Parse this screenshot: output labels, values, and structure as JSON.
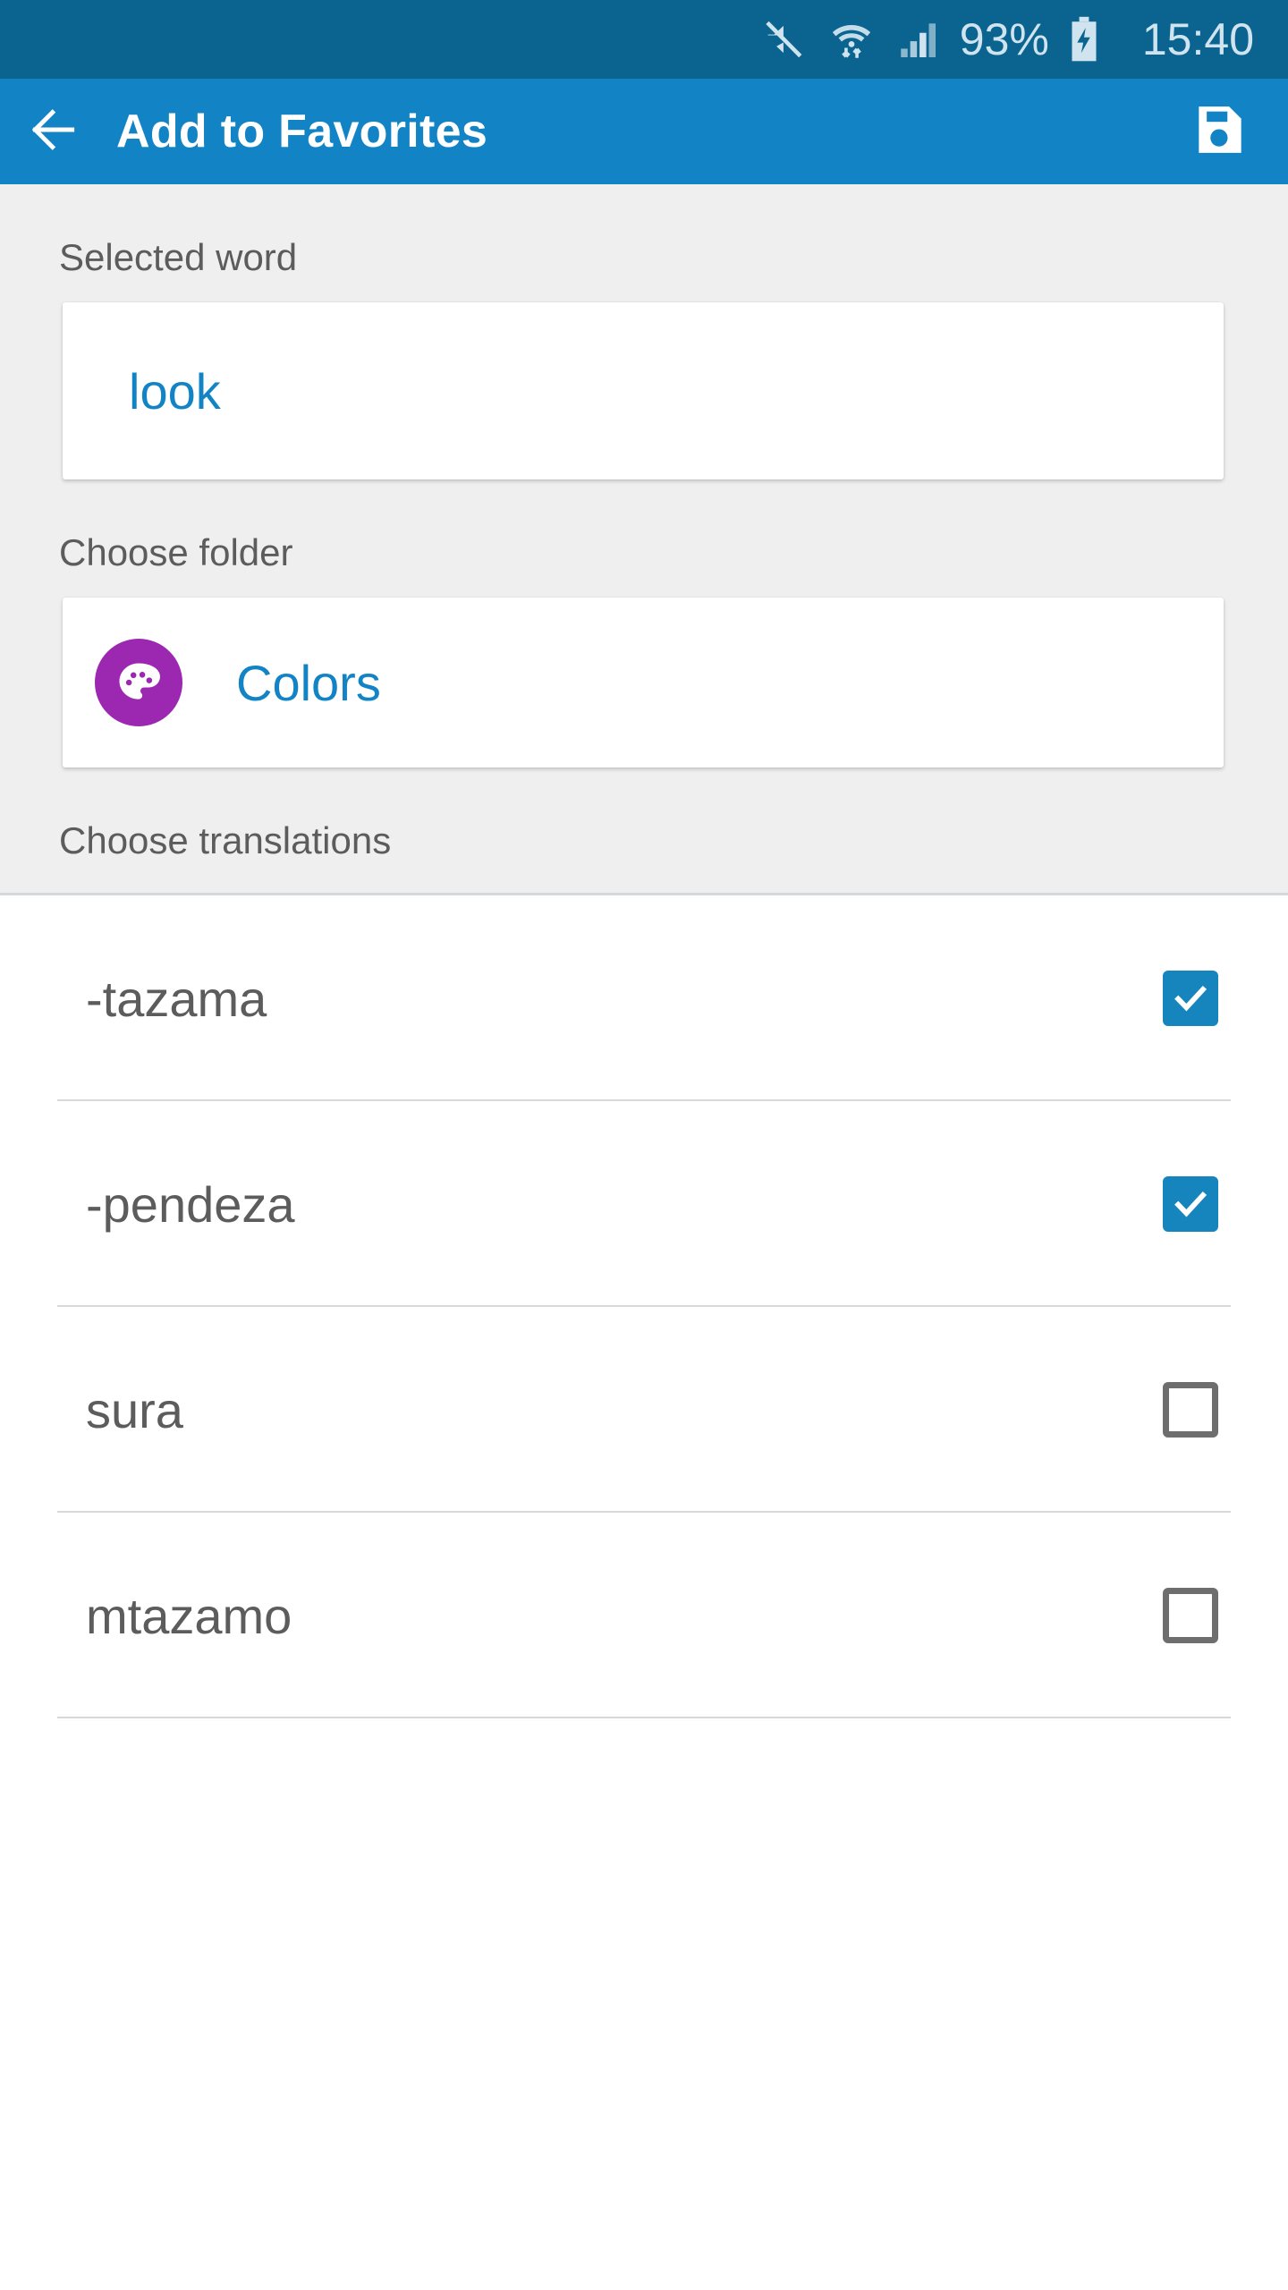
{
  "statusbar": {
    "icons": [
      "mute-icon",
      "wifi-transfer-icon",
      "signal-bars-icon"
    ],
    "battery_percent": "93%",
    "battery_state": "charging",
    "clock": "15:40",
    "bg_color": "#0b6390",
    "fg_color": "#cfe4ef"
  },
  "appbar": {
    "back_icon": "arrow-left-icon",
    "title": "Add to Favorites",
    "save_icon": "floppy-disk-save-icon",
    "bg_color": "#1284c6",
    "title_color": "#ffffff"
  },
  "form": {
    "selected_word": {
      "label": "Selected word",
      "value": "look",
      "value_color": "#1284c6"
    },
    "choose_folder": {
      "label": "Choose folder",
      "folder_name": "Colors",
      "folder_icon": "palette-icon",
      "folder_icon_color": "#9c27b0",
      "name_color": "#1284c6"
    },
    "choose_translations": {
      "label": "Choose translations"
    },
    "bg_color": "#efefef",
    "label_color": "#5c5c5c"
  },
  "translations": {
    "items": [
      {
        "label": "-tazama",
        "checked": true
      },
      {
        "label": "-pendeza",
        "checked": true
      },
      {
        "label": "sura",
        "checked": false
      },
      {
        "label": "mtazamo",
        "checked": false
      }
    ],
    "checked_color": "#1785bd",
    "unchecked_border_color": "#6e6e6e",
    "text_color": "#5c5c5c"
  }
}
